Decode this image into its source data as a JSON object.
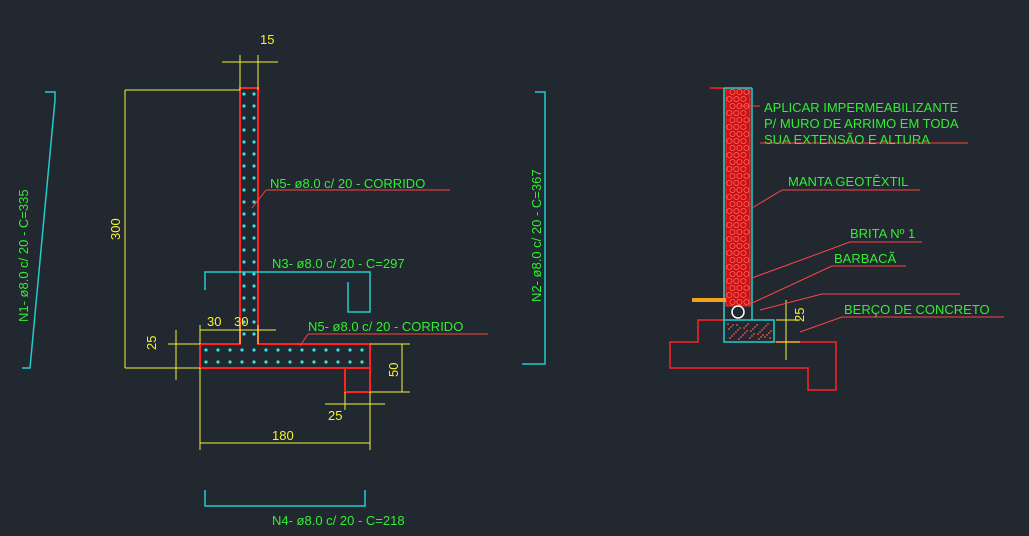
{
  "colors": {
    "background": "#212830",
    "concrete": "#ff2222",
    "rebar": "#ff6666",
    "dots": "#44dddd",
    "dimension": "#f2f233",
    "text": "#33ee33",
    "outline": "#22cccc",
    "leader": "#ff4444"
  },
  "section": {
    "dim_top": "15",
    "dim_height": "300",
    "dim_footing_thickness": "25",
    "dim_30_left": "30",
    "dim_30_right": "30",
    "dim_step": "50",
    "dim_toe": "25",
    "dim_base": "180",
    "label_n5_wall": "N5- ø8.0  c/ 20 - CORRIDO",
    "label_n3": "N3- ø8.0  c/ 20 - C=297",
    "label_n5_base": "N5- ø8.0  c/ 20 - CORRIDO",
    "label_n1": "N1- ø8.0  c/ 20 - C=335",
    "label_n2": "N2- ø8.0  c/ 20 - C=367",
    "label_n4": "N4- ø8.0  c/ 20 - C=218"
  },
  "detail": {
    "note_line1": "APLICAR IMPERMEABILIZANTE",
    "note_line2": "P/ MURO DE ARRIMO EM TODA",
    "note_line3": "SUA EXTENSÃO E ALTURA",
    "manta": "MANTA GEOTÊXTIL",
    "brita": "BRITA Nº 1",
    "barbaca": "BARBACÃ",
    "berco": "BERÇO DE CONCRETO",
    "dim_berco": "25"
  }
}
